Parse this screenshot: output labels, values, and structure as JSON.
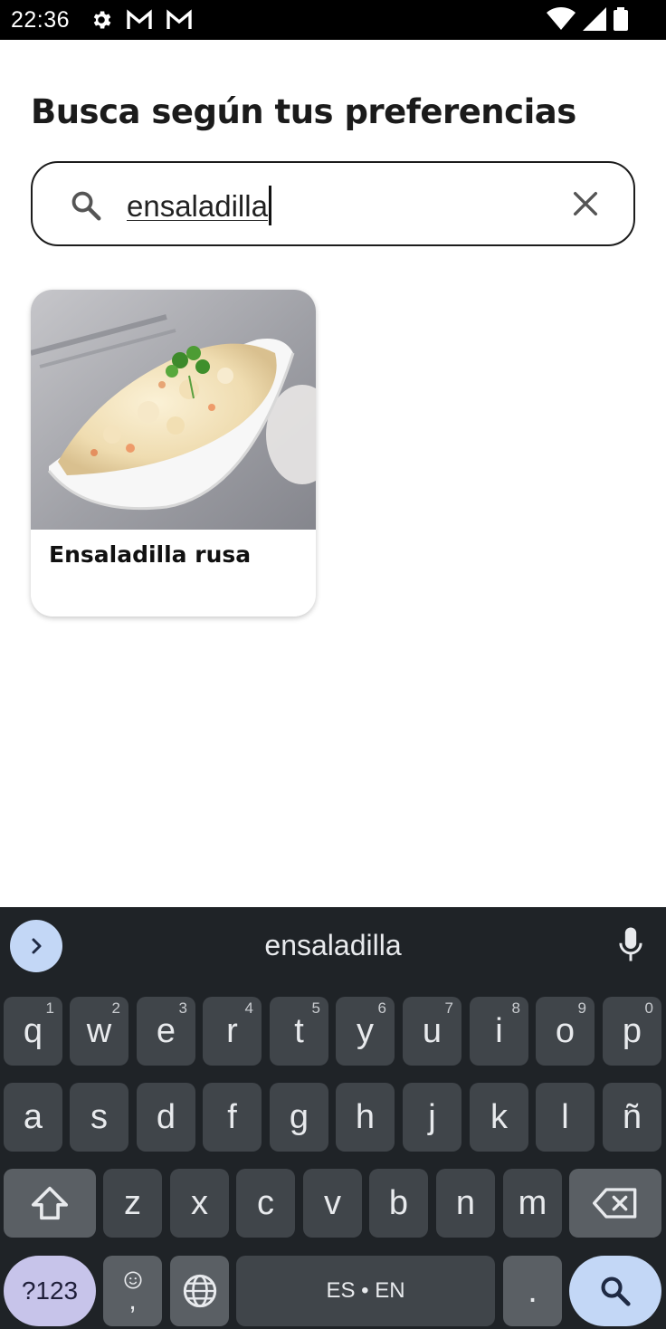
{
  "status_bar": {
    "time": "22:36",
    "left_icons": [
      "gear-icon",
      "gmail-icon",
      "gmail-icon"
    ],
    "right_icons": [
      "wifi-icon",
      "signal-icon",
      "battery-icon"
    ]
  },
  "page": {
    "title": "Busca según tus preferencias"
  },
  "search": {
    "value": "ensaladilla",
    "icon": "search-icon",
    "clear_icon": "close-icon"
  },
  "results": [
    {
      "title": "Ensaladilla rusa",
      "image": "potato-salad-photo"
    }
  ],
  "keyboard": {
    "suggestion": "ensaladilla",
    "row1": [
      {
        "key": "q",
        "hint": "1"
      },
      {
        "key": "w",
        "hint": "2"
      },
      {
        "key": "e",
        "hint": "3"
      },
      {
        "key": "r",
        "hint": "4"
      },
      {
        "key": "t",
        "hint": "5"
      },
      {
        "key": "y",
        "hint": "6"
      },
      {
        "key": "u",
        "hint": "7"
      },
      {
        "key": "i",
        "hint": "8"
      },
      {
        "key": "o",
        "hint": "9"
      },
      {
        "key": "p",
        "hint": "0"
      }
    ],
    "row2": [
      "a",
      "s",
      "d",
      "f",
      "g",
      "h",
      "j",
      "k",
      "l",
      "ñ"
    ],
    "row3": [
      "z",
      "x",
      "c",
      "v",
      "b",
      "n",
      "m"
    ],
    "symbols_label": "?123",
    "comma_label": ",",
    "space_label": "ES • EN",
    "period_label": ".",
    "colors": {
      "background": "#1f2327",
      "key": "#40454a",
      "accent": "#c3d7f6"
    }
  }
}
